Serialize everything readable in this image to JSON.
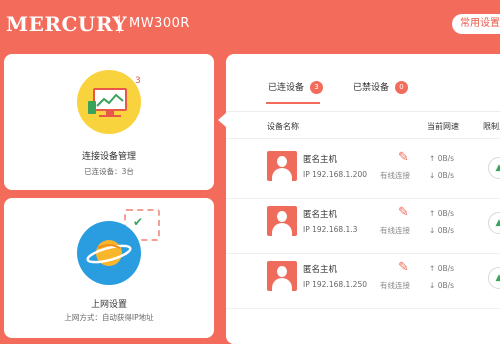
{
  "header": {
    "brand": "MERCURY",
    "model": "MW300R",
    "common_button": "常用设置"
  },
  "cards": {
    "devices": {
      "badge": "3",
      "title": "连接设备管理",
      "subtitle": "已连设备：3台"
    },
    "internet": {
      "title": "上网设置",
      "subtitle": "上网方式：自动获得IP地址"
    }
  },
  "tabs": [
    {
      "label": "已连设备",
      "count": "3"
    },
    {
      "label": "已禁设备",
      "count": "0"
    }
  ],
  "columns": {
    "name": "设备名称",
    "speed": "当前网速",
    "limit": "限制上"
  },
  "devices": [
    {
      "name": "匿名主机",
      "ip": "IP 192.168.1.200",
      "conn": "有线连接",
      "up": "0B/s",
      "down": "0B/s"
    },
    {
      "name": "匿名主机",
      "ip": "IP 192.168.1.3",
      "conn": "有线连接",
      "up": "0B/s",
      "down": "0B/s"
    },
    {
      "name": "匿名主机",
      "ip": "IP 192.168.1.250",
      "conn": "有线连接",
      "up": "0B/s",
      "down": "0B/s"
    }
  ],
  "colors": {
    "brand_red": "#f26b5b",
    "accent_yellow": "#f9d33e",
    "accent_blue": "#2a9ce0",
    "ok_green": "#3aa35b"
  }
}
